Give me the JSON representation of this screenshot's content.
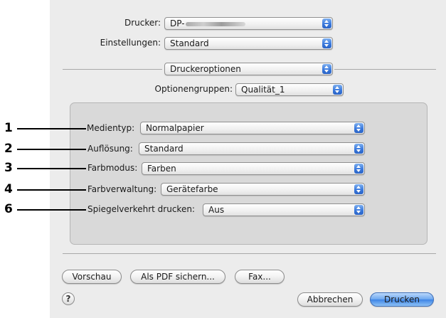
{
  "printer": {
    "label": "Drucker:",
    "value": "DP-"
  },
  "settings": {
    "label": "Einstellungen:",
    "value": "Standard"
  },
  "panel_selector": {
    "value": "Druckeroptionen"
  },
  "option_groups": {
    "label": "Optionengruppen:",
    "value": "Qualität_1"
  },
  "options": [
    {
      "callout": "1",
      "label": "Medientyp:",
      "value": "Normalpapier"
    },
    {
      "callout": "2",
      "label": "Auflösung:",
      "value": "Standard"
    },
    {
      "callout": "3",
      "label": "Farbmodus:",
      "value": "Farben"
    },
    {
      "callout": "4",
      "label": "Farbverwaltung:",
      "value": "Gerätefarbe"
    },
    {
      "callout": "6",
      "label": "Spiegelverkehrt drucken:",
      "value": "Aus"
    }
  ],
  "buttons": {
    "preview": "Vorschau",
    "save_pdf": "Als PDF sichern...",
    "fax": "Fax...",
    "cancel": "Abbrechen",
    "print": "Drucken",
    "help": "?"
  },
  "colors": {
    "dialog_background": "#ececec",
    "group_background": "#d9d9d9",
    "popup_arrow_blue": "#3a79dd",
    "default_button_blue": "#6aa5ef"
  },
  "icons": {
    "popup_arrows": "up-down-arrows",
    "help": "question-mark"
  }
}
